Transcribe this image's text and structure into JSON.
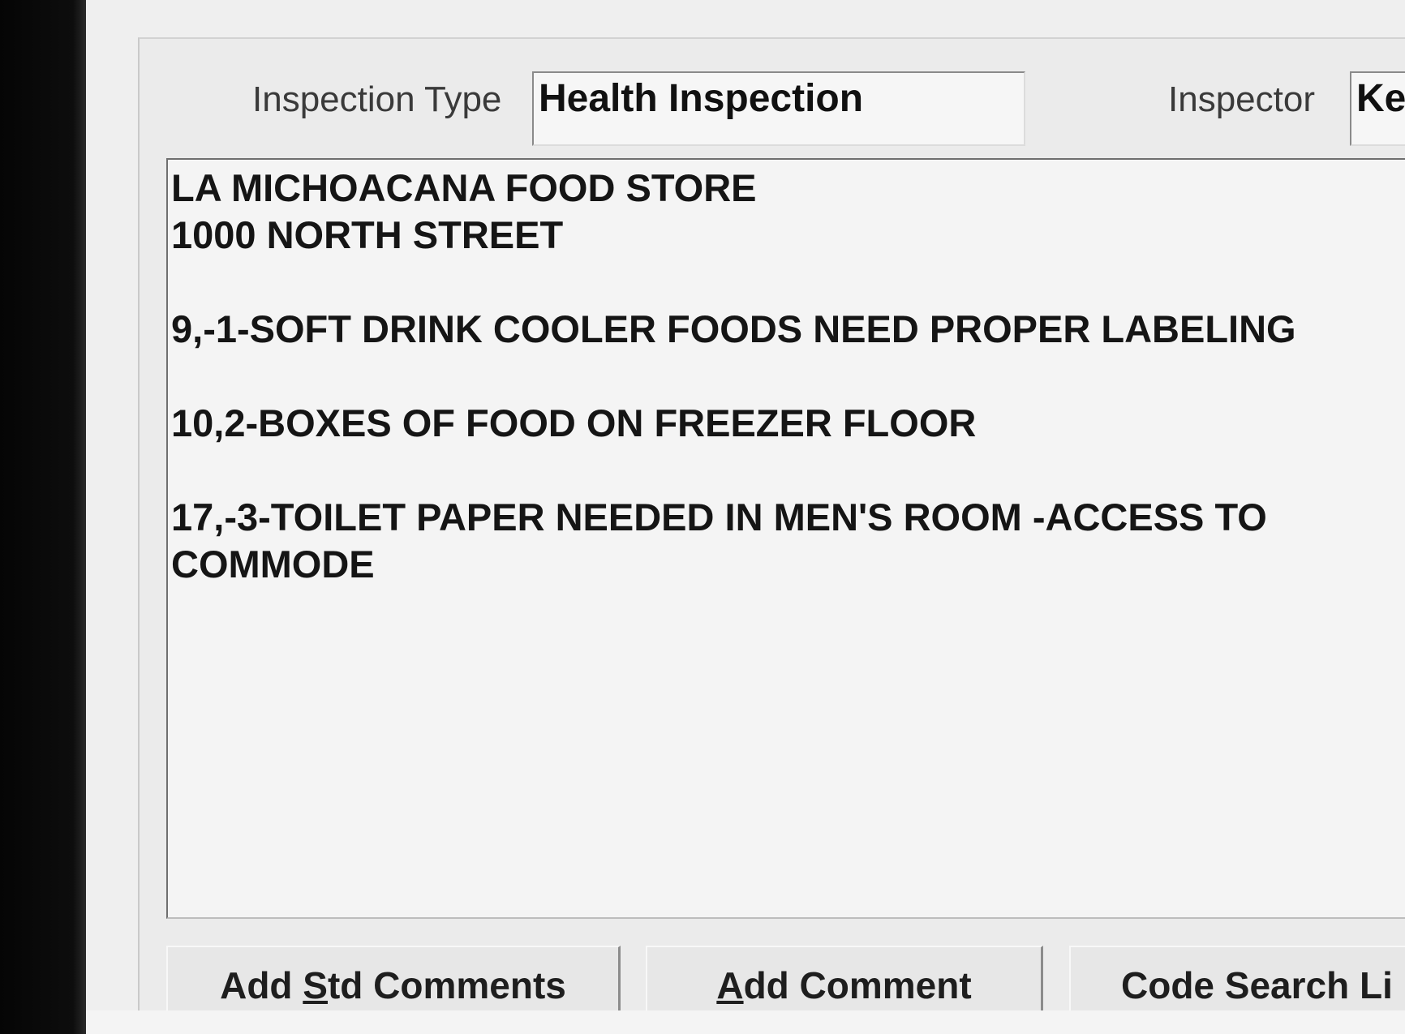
{
  "header": {
    "inspection_type_label": "Inspection Type",
    "inspection_type_value": "Health Inspection",
    "inspector_label": "Inspector",
    "inspector_value": "Ke"
  },
  "comments": {
    "text": "LA MICHOACANA FOOD STORE\n1000 NORTH STREET\n\n9,-1-SOFT DRINK COOLER FOODS NEED PROPER LABELING\n\n10,2-BOXES OF FOOD ON FREEZER FLOOR\n\n17,-3-TOILET PAPER NEEDED IN MEN'S ROOM -ACCESS TO COMMODE"
  },
  "buttons": {
    "add_std_comments": {
      "pre": "Add ",
      "key": "S",
      "post": "td Comments"
    },
    "add_comment": {
      "pre": "",
      "key": "A",
      "post": "dd Comment"
    },
    "code_search": {
      "label": "Code Search Li"
    }
  }
}
